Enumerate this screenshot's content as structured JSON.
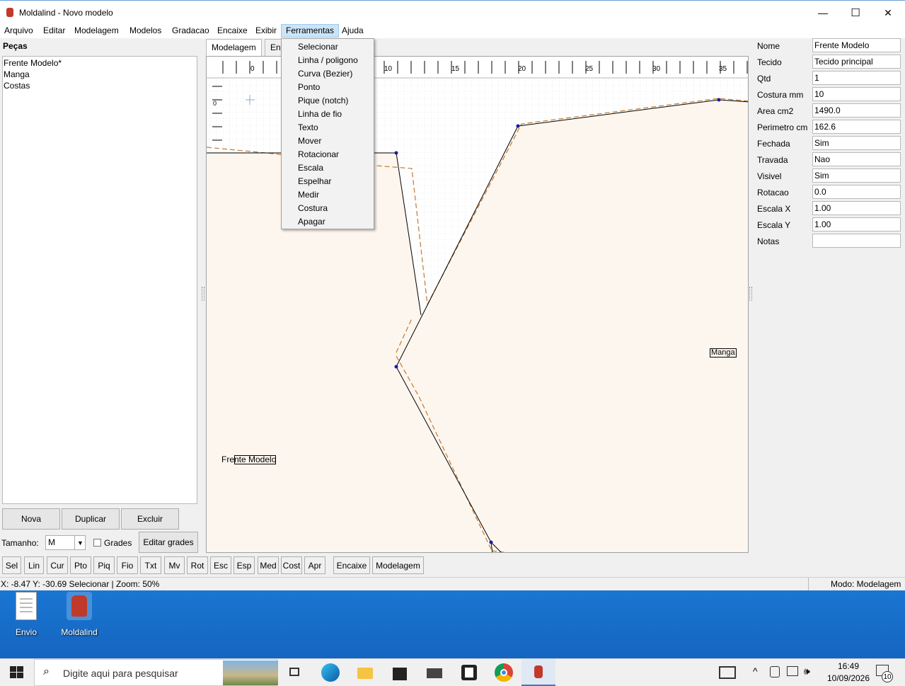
{
  "window": {
    "title": "Moldalind - Novo modelo",
    "minimize": "—",
    "maximize": "☐",
    "close": "✕"
  },
  "menu": [
    "Arquivo",
    "Editar",
    "Modelagem",
    "Modelos",
    "Gradacao",
    "Encaixe",
    "Exibir",
    "Ferramentas",
    "Ajuda"
  ],
  "left": {
    "heading": "Peças",
    "pieces": [
      "Frente Modelo*",
      "Manga",
      "Costas"
    ],
    "btn_nova": "Nova",
    "btn_duplicar": "Duplicar",
    "btn_excluir": "Excluir",
    "tamanho_label": "Tamanho:",
    "tamanho_value": "M",
    "grades_label": "Grades",
    "editar_grades": "Editar grades"
  },
  "tabs": [
    "Modelagem",
    "Enc"
  ],
  "ruler": {
    "h_labels": [
      "0",
      "10",
      "15",
      "20",
      "25",
      "30",
      "35"
    ],
    "v_labels": [
      "0"
    ]
  },
  "canvas": {
    "label_frente": "Frente Modelo",
    "label_manga": "Manga",
    "colors": {
      "fill": "#fdf6ef",
      "outline": "#000000",
      "seam": "#c07a30",
      "point": "#1a1aa0",
      "grid": "#cfd8e3"
    }
  },
  "dropdown": [
    "Selecionar",
    "Linha / poligono",
    "Curva (Bezier)",
    "Ponto",
    "Pique (notch)",
    "Linha de fio",
    "Texto",
    "Mover",
    "Rotacionar",
    "Escala",
    "Espelhar",
    "Medir",
    "Costura",
    "Apagar"
  ],
  "props": [
    {
      "label": "Nome",
      "value": "Frente Modelo"
    },
    {
      "label": "Tecido",
      "value": "Tecido principal"
    },
    {
      "label": "Qtd",
      "value": "1"
    },
    {
      "label": "Costura mm",
      "value": "10"
    },
    {
      "label": "Area cm2",
      "value": "1490.0"
    },
    {
      "label": "Perimetro cm",
      "value": "162.6"
    },
    {
      "label": "Fechada",
      "value": "Sim"
    },
    {
      "label": "Travada",
      "value": "Nao"
    },
    {
      "label": "Visivel",
      "value": "Sim"
    },
    {
      "label": "Rotacao",
      "value": "0.0"
    },
    {
      "label": "Escala X",
      "value": "1.00"
    },
    {
      "label": "Escala Y",
      "value": "1.00"
    },
    {
      "label": "Notas",
      "value": ""
    }
  ],
  "tools": [
    "Sel",
    "Lin",
    "Cur",
    "Pto",
    "Piq",
    "Fio",
    "Txt",
    "Mv",
    "Rot",
    "Esc",
    "Esp",
    "Med",
    "Cost",
    "Apr"
  ],
  "tools_extra": [
    "Encaixe",
    "Modelagem"
  ],
  "status": {
    "left": "X: -8.47  Y: -30.69  Selecionar  |  Zoom: 50%",
    "right": "Modo: Modelagem"
  },
  "desktop": {
    "icons": [
      "Envio",
      "Moldalind"
    ]
  },
  "taskbar": {
    "search_placeholder": "Digite aqui para pesquisar",
    "time": "16:49",
    "date": "10/09/2026",
    "notif_count": "10"
  }
}
